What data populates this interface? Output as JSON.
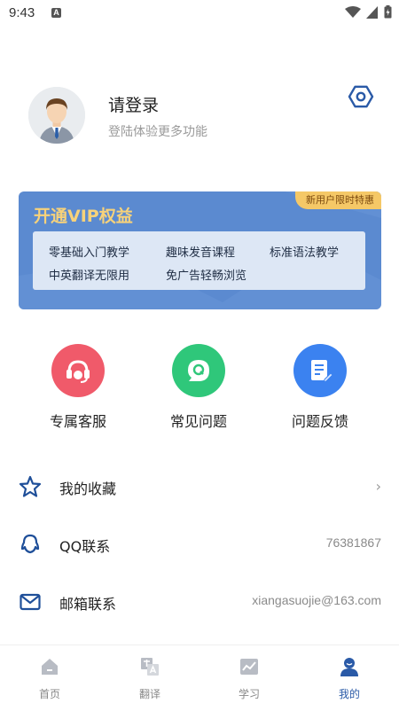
{
  "status_bar": {
    "time": "9:43",
    "notification_letter": "A"
  },
  "profile": {
    "title": "请登录",
    "subtitle": "登陆体验更多功能"
  },
  "vip": {
    "badge": "新用户限时特惠",
    "title": "开通VIP权益",
    "items": [
      "零基础入门教学",
      "趣味发音课程",
      "标准语法教学",
      "中英翻译无限用",
      "免广告轻畅浏览"
    ]
  },
  "features": [
    {
      "label": "专属客服",
      "icon": "headset-icon",
      "color": "#f05a6a"
    },
    {
      "label": "常见问题",
      "icon": "q-chat-icon",
      "color": "#2fc77a"
    },
    {
      "label": "问题反馈",
      "icon": "feedback-doc-icon",
      "color": "#3b82f0"
    }
  ],
  "list": [
    {
      "label": "我的收藏",
      "icon": "star-icon",
      "value": "",
      "chevron": "›"
    },
    {
      "label": "QQ联系",
      "icon": "qq-icon",
      "value": "76381867"
    },
    {
      "label": "邮箱联系",
      "icon": "mail-icon",
      "value": "xiangasuojie@163.com"
    }
  ],
  "tabs": [
    {
      "label": "首页",
      "icon": "home-icon",
      "active": false
    },
    {
      "label": "翻译",
      "icon": "translate-icon",
      "active": false
    },
    {
      "label": "学习",
      "icon": "study-chart-icon",
      "active": false
    },
    {
      "label": "我的",
      "icon": "profile-icon",
      "active": true
    }
  ],
  "colors": {
    "accent": "#2a5aa7",
    "vip_bg": "#5b8ad0",
    "vip_gold": "#f7d27a"
  }
}
